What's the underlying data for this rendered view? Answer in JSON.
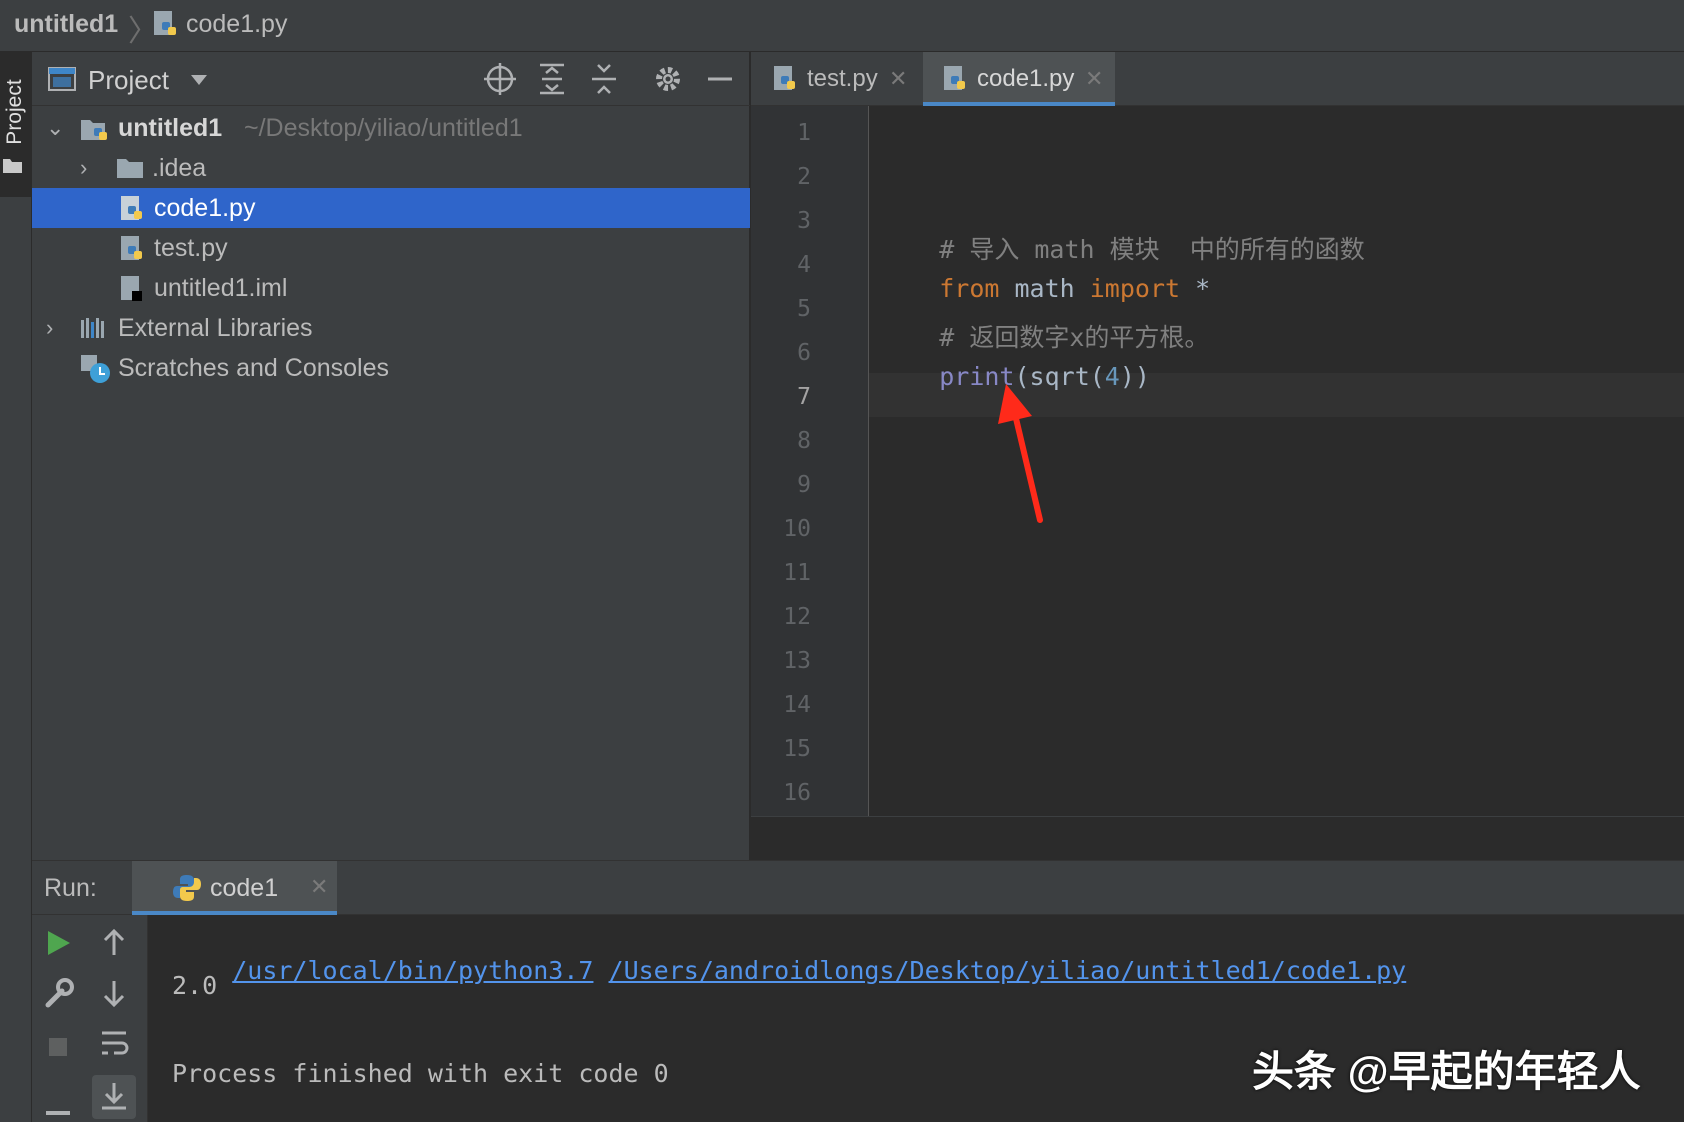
{
  "breadcrumb": {
    "project": "untitled1",
    "separator": "〉",
    "file": "code1.py"
  },
  "tool_stripe": {
    "project_label": "Project"
  },
  "project_panel": {
    "title": "Project",
    "dropdown_icon": "caret-down-icon",
    "tools": [
      "locate-icon",
      "expand-all-icon",
      "collapse-all-icon",
      "gear-icon",
      "minimize-icon"
    ],
    "tree": [
      {
        "label": "untitled1",
        "path": "~/Desktop/yiliao/untitled1",
        "icon": "project-folder-icon",
        "expanded": true
      },
      {
        "label": ".idea",
        "icon": "folder-icon",
        "expanded": false
      },
      {
        "label": "code1.py",
        "icon": "python-file-icon",
        "selected": true
      },
      {
        "label": "test.py",
        "icon": "python-file-icon"
      },
      {
        "label": "untitled1.iml",
        "icon": "iml-file-icon"
      },
      {
        "label": "External Libraries",
        "icon": "libraries-icon",
        "expanded": false
      },
      {
        "label": "Scratches and Consoles",
        "icon": "scratches-icon"
      }
    ]
  },
  "editor_tabs": [
    {
      "label": "test.py",
      "active": false
    },
    {
      "label": "code1.py",
      "active": true
    }
  ],
  "editor": {
    "line_numbers": [
      "1",
      "2",
      "3",
      "4",
      "5",
      "6",
      "7",
      "8",
      "9",
      "10",
      "11",
      "12",
      "13",
      "14",
      "15",
      "16"
    ],
    "current_line": "7",
    "lines": {
      "l3": "# 导入 math 模块  中的所有的函数",
      "l4_kw1": "from",
      "l4_mid": " math ",
      "l4_kw2": "import",
      "l4_end": " *",
      "l5": "# 返回数字x的平方根。",
      "l6_fn": "print",
      "l6_a": "(sqrt(",
      "l6_num": "4",
      "l6_b": "))"
    }
  },
  "run_panel": {
    "label": "Run:",
    "tab_label": "code1",
    "output": {
      "interpreter_path": "/usr/local/bin/python3.7",
      "script_path": "/Users/androidlongs/Desktop/yiliao/untitled1/code1.py",
      "result": "2.0",
      "exit_message": "Process finished with exit code 0"
    }
  },
  "watermark": "头条 @早起的年轻人",
  "colors": {
    "selection": "#2f65ca",
    "keyword": "#cc7832",
    "builtin": "#8888c6",
    "number": "#6897bb",
    "comment": "#808080",
    "link": "#5394ec",
    "annotation_arrow": "#ff2a1a"
  }
}
